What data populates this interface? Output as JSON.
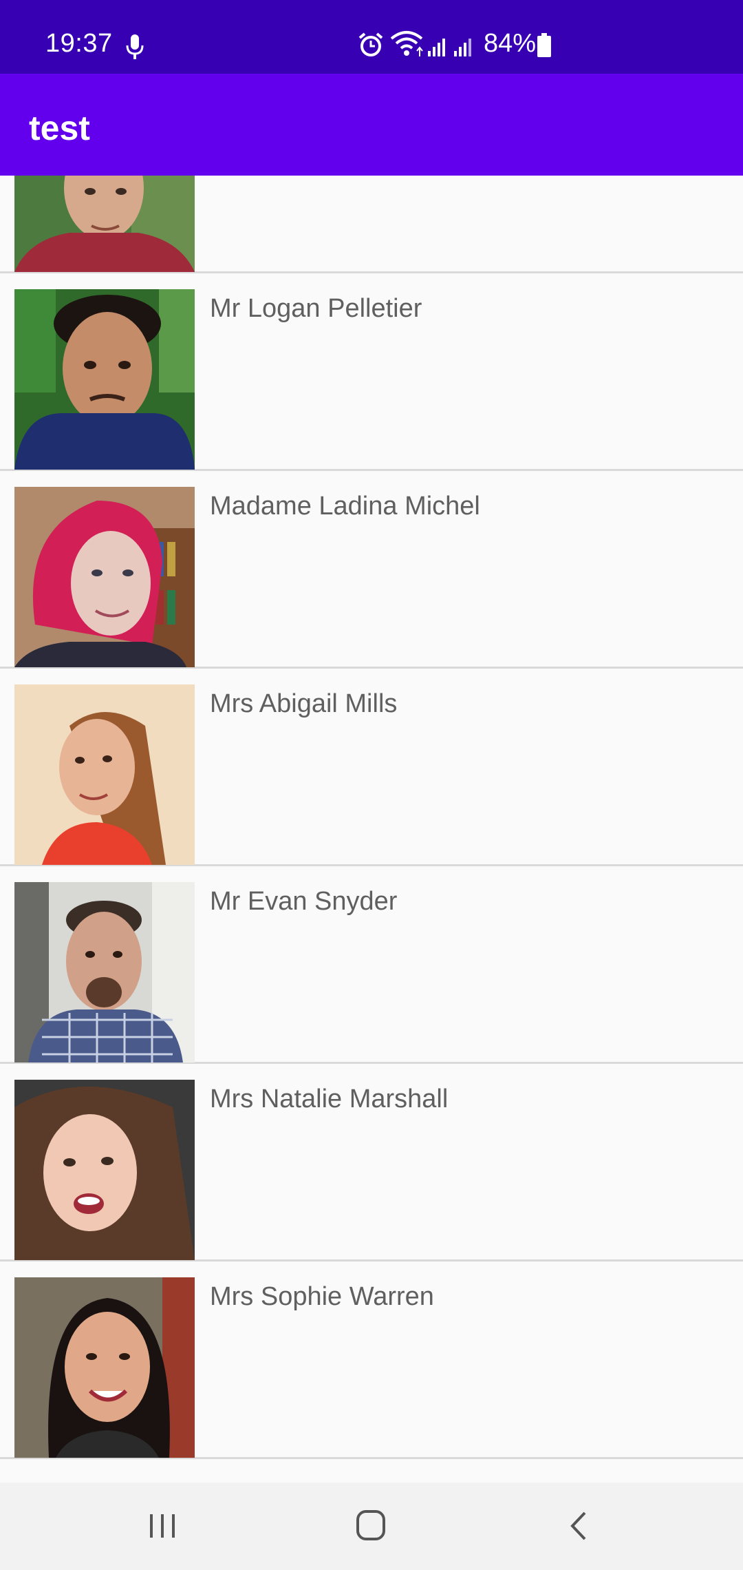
{
  "status_bar": {
    "time": "19:37",
    "battery": "84%",
    "icons": [
      "mic-icon",
      "alarm-icon",
      "wifi-icon",
      "signal-icon",
      "signal-icon",
      "battery-icon"
    ]
  },
  "app_bar": {
    "title": "test"
  },
  "colors": {
    "status_bar": "#3700b3",
    "app_bar": "#6200ee",
    "list_background": "#fafafa",
    "divider": "#d9d9d9",
    "name_text": "#5f5f5f",
    "nav_bar": "#f2f2f2"
  },
  "people": [
    {
      "name": ""
    },
    {
      "name": "Mr Logan Pelletier"
    },
    {
      "name": "Madame Ladina Michel"
    },
    {
      "name": "Mrs Abigail Mills"
    },
    {
      "name": "Mr Evan Snyder"
    },
    {
      "name": "Mrs Natalie Marshall"
    },
    {
      "name": "Mrs Sophie Warren"
    }
  ],
  "nav_bar": {
    "buttons": [
      "recent-apps-icon",
      "home-icon",
      "back-icon"
    ]
  }
}
